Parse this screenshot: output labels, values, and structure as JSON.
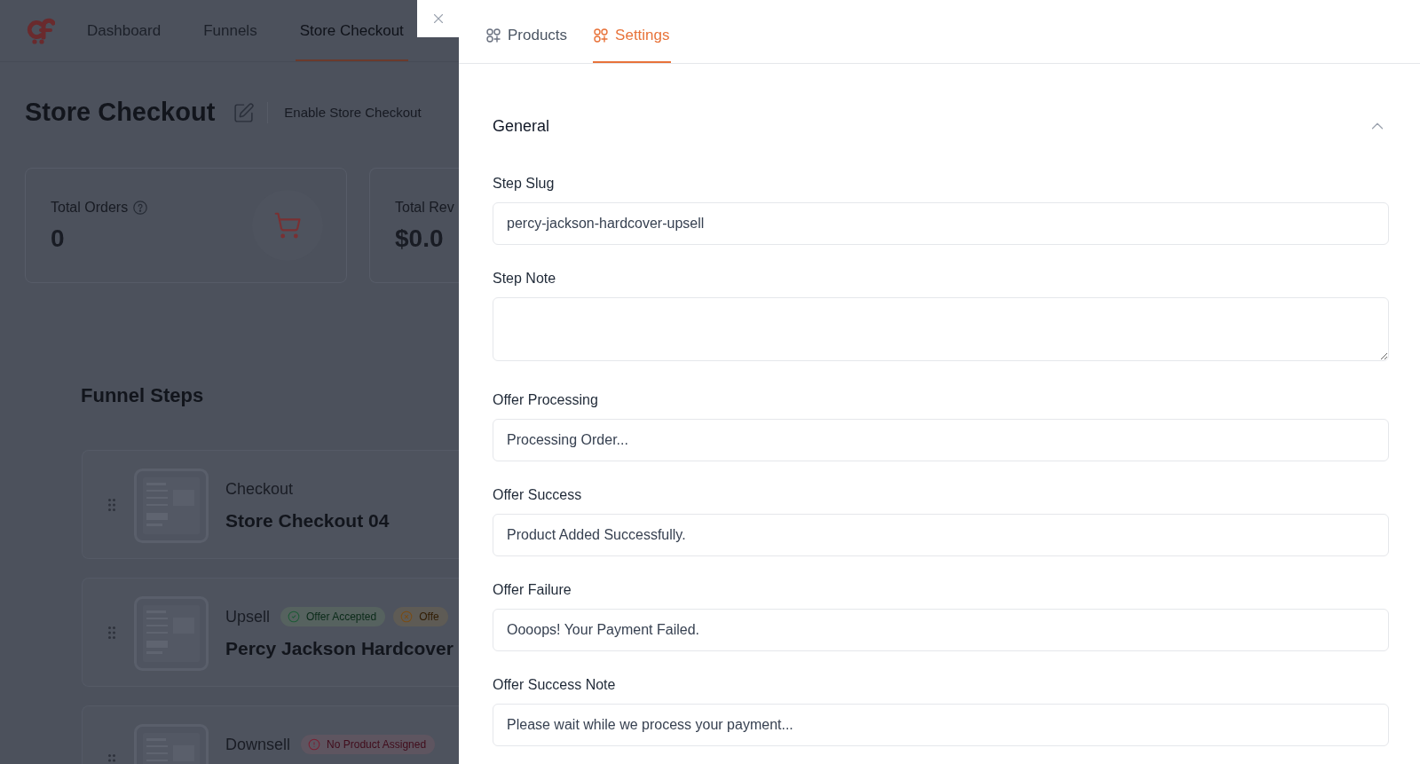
{
  "nav": {
    "items": [
      {
        "label": "Dashboard",
        "selected": false
      },
      {
        "label": "Funnels",
        "selected": false
      },
      {
        "label": "Store Checkout",
        "selected": true
      }
    ]
  },
  "header": {
    "title": "Store Checkout",
    "toggle_label": "Enable Store Checkout"
  },
  "stats": [
    {
      "kind": "orders",
      "label": "Total Orders",
      "help": true,
      "value": "0"
    },
    {
      "kind": "revenue",
      "label": "Total Rev",
      "value": "$0.0"
    }
  ],
  "funnel_steps": {
    "title": "Funnel Steps",
    "steps": [
      {
        "type": "Checkout",
        "name": "Store Checkout 04"
      },
      {
        "type": "Upsell",
        "badges": [
          {
            "kind": "accepted",
            "label": "Offer Accepted"
          },
          {
            "kind": "rejected",
            "label": "Offe"
          }
        ],
        "name": "Percy Jackson Hardcover"
      },
      {
        "type": "Downsell",
        "badges": [
          {
            "kind": "missing",
            "label": "No Product Assigned"
          }
        ]
      }
    ]
  },
  "drawer": {
    "tabs": [
      {
        "label": "Products",
        "selected": false
      },
      {
        "label": "Settings",
        "selected": true
      }
    ],
    "section": {
      "title": "General",
      "expanded": true,
      "fields": [
        {
          "label": "Step Slug",
          "kind": "input",
          "value": "percy-jackson-hardcover-upsell"
        },
        {
          "label": "Step Note",
          "kind": "textarea"
        },
        {
          "label": "Offer Processing",
          "kind": "input",
          "value": "Processing Order..."
        },
        {
          "label": "Offer Success",
          "kind": "input",
          "value": "Product Added Successfully."
        },
        {
          "label": "Offer Failure",
          "kind": "input",
          "value": "Oooops! Your Payment Failed."
        },
        {
          "label": "Offer Success Note",
          "kind": "input",
          "value": "Please wait while we process your payment..."
        }
      ]
    }
  }
}
